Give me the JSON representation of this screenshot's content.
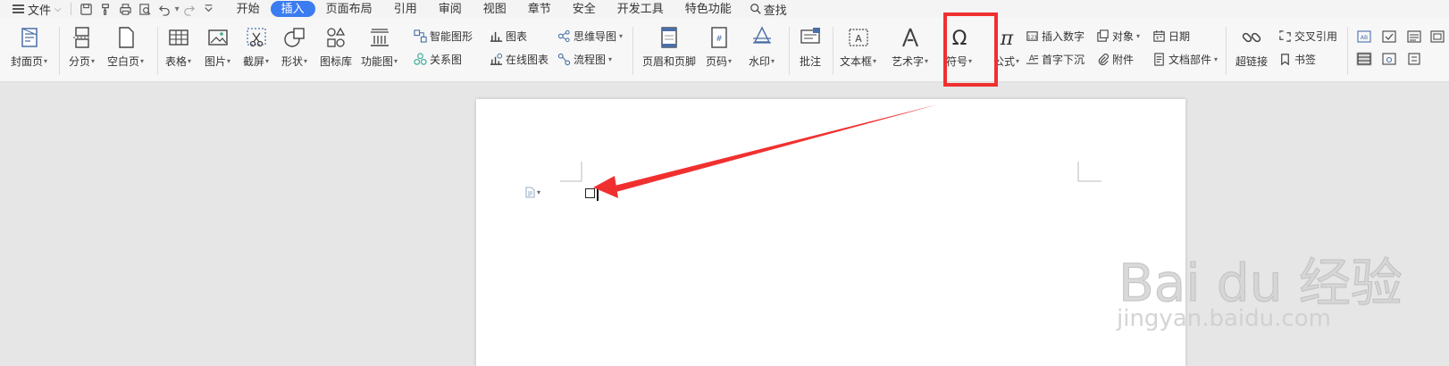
{
  "menubar": {
    "file_label": "文件",
    "tabs": [
      {
        "label": "开始",
        "active": false
      },
      {
        "label": "插入",
        "active": true
      },
      {
        "label": "页面布局",
        "active": false
      },
      {
        "label": "引用",
        "active": false
      },
      {
        "label": "审阅",
        "active": false
      },
      {
        "label": "视图",
        "active": false
      },
      {
        "label": "章节",
        "active": false
      },
      {
        "label": "安全",
        "active": false
      },
      {
        "label": "开发工具",
        "active": false
      },
      {
        "label": "特色功能",
        "active": false
      }
    ],
    "search_label": "查找",
    "accent_color": "#3b7cf0"
  },
  "ribbon": {
    "cover_page": "封面页",
    "page_break": "分页",
    "blank_page": "空白页",
    "table": "表格",
    "picture": "图片",
    "screenshot": "截屏",
    "shape": "形状",
    "icon_library": "图标库",
    "function_chart": "功能图",
    "smart_shape": "智能图形",
    "chart": "图表",
    "mind_map": "思维导图",
    "relationship": "关系图",
    "online_chart": "在线图表",
    "flowchart": "流程图",
    "header_footer": "页眉和页脚",
    "page_number": "页码",
    "watermark": "水印",
    "comment": "批注",
    "text_box": "文本框",
    "word_art": "艺术字",
    "symbol": "符号",
    "formula": "公式",
    "insert_number": "插入数字",
    "object": "对象",
    "date": "日期",
    "drop_cap": "首字下沉",
    "attachment": "附件",
    "doc_parts": "文档部件",
    "hyperlink": "超链接",
    "cross_reference": "交叉引用",
    "bookmark": "书签"
  },
  "annotation": {
    "highlight_color": "#f0302f",
    "target": "符号"
  },
  "watermark_overlay": {
    "main": "Bai du 经验",
    "sub": "jingyan.baidu.com"
  }
}
